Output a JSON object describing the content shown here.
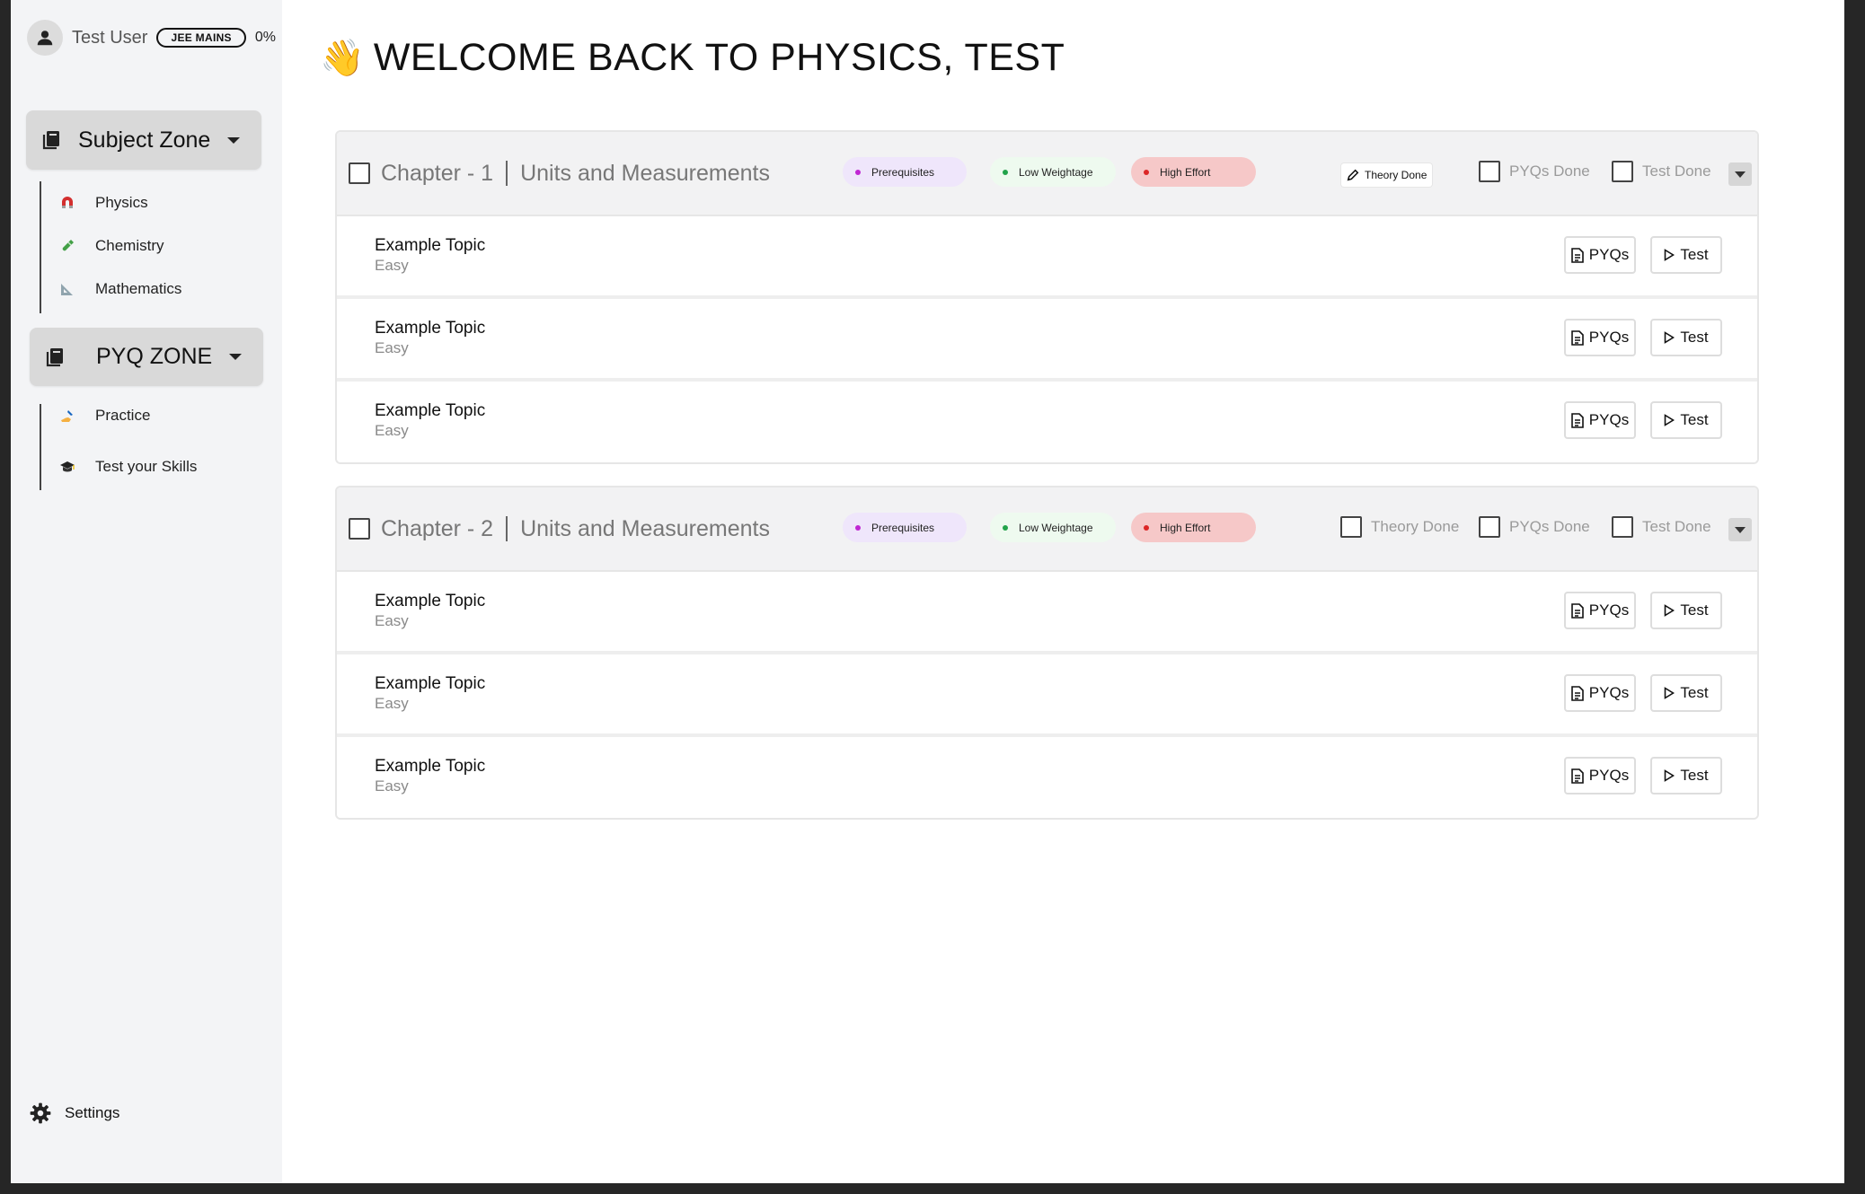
{
  "user": {
    "name": "Test User",
    "exam_badge": "JEE MAINS",
    "progress": "0%"
  },
  "sidebar": {
    "subject_zone": {
      "label": "Subject Zone",
      "items": [
        {
          "label": "Physics",
          "icon": "magnet-icon"
        },
        {
          "label": "Chemistry",
          "icon": "test-tube-icon"
        },
        {
          "label": "Mathematics",
          "icon": "set-square-icon"
        }
      ]
    },
    "pyq_zone": {
      "label": "PYQ ZONE",
      "items": [
        {
          "label": "Practice",
          "icon": "writing-hand-icon"
        },
        {
          "label": "Test your Skills",
          "icon": "graduation-cap-icon"
        }
      ]
    },
    "settings_label": "Settings"
  },
  "main": {
    "welcome_emoji": "👋",
    "welcome_title": "WELCOME BACK TO PHYSICS, TEST",
    "chapters": [
      {
        "number": "Chapter - 1",
        "name": "Units and Measurements",
        "tags": {
          "prerequisites": "Prerequisites",
          "weightage": "Low Weightage",
          "effort": "High Effort"
        },
        "theory": "Theory Done",
        "pyqs_done": "PYQs Done",
        "test_done": "Test Done",
        "topics": [
          {
            "name": "Example Topic",
            "level": "Easy",
            "pyq_label": "PYQs",
            "test_label": "Test"
          },
          {
            "name": "Example Topic",
            "level": "Easy",
            "pyq_label": "PYQs",
            "test_label": "Test"
          },
          {
            "name": "Example Topic",
            "level": "Easy",
            "pyq_label": "PYQs",
            "test_label": "Test"
          }
        ]
      },
      {
        "number": "Chapter - 2",
        "name": "Units and Measurements",
        "tags": {
          "prerequisites": "Prerequisites",
          "weightage": "Low Weightage",
          "effort": "High Effort"
        },
        "theory": "Theory Done",
        "pyqs_done": "PYQs Done",
        "test_done": "Test Done",
        "topics": [
          {
            "name": "Example Topic",
            "level": "Easy",
            "pyq_label": "PYQs",
            "test_label": "Test"
          },
          {
            "name": "Example Topic",
            "level": "Easy",
            "pyq_label": "PYQs",
            "test_label": "Test"
          },
          {
            "name": "Example Topic",
            "level": "Easy",
            "pyq_label": "PYQs",
            "test_label": "Test"
          }
        ]
      }
    ]
  },
  "colors": {
    "sidebar_bg": "#f3f4f6",
    "zone_bg": "#d9d9d9",
    "prerequisites_dot": "#c026d3",
    "weightage_dot": "#22a34a",
    "effort_dot": "#dc2626"
  }
}
